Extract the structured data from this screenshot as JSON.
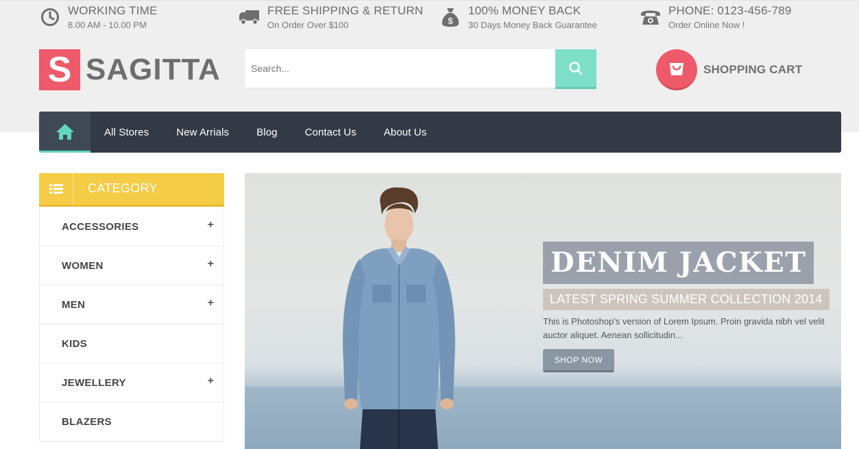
{
  "topbar": {
    "items": [
      {
        "icon": "clock-icon",
        "title": "WORKING TIME",
        "subtitle": "8.00 AM - 10.00 PM"
      },
      {
        "icon": "truck-icon",
        "title": "FREE SHIPPING & RETURN",
        "subtitle": "On Order Over $100"
      },
      {
        "icon": "money-bag-icon",
        "title": "100% MONEY BACK",
        "subtitle": "30 Days Money Back Guarantee"
      },
      {
        "icon": "phone-icon",
        "title": "PHONE: 0123-456-789",
        "subtitle": "Order Online Now !"
      }
    ]
  },
  "logo": {
    "letter": "S",
    "name": "SAGITTA"
  },
  "search": {
    "placeholder": "Search..."
  },
  "cart": {
    "label": "SHOPPING CART"
  },
  "nav": {
    "items": [
      "All Stores",
      "New Arrials",
      "Blog",
      "Contact Us",
      "About Us"
    ]
  },
  "category": {
    "title": "CATEGORY",
    "items": [
      {
        "label": "ACCESSORIES",
        "expand": "+"
      },
      {
        "label": "WOMEN",
        "expand": "+"
      },
      {
        "label": "MEN",
        "expand": "+"
      },
      {
        "label": "KIDS",
        "expand": ""
      },
      {
        "label": "JEWELLERY",
        "expand": "+"
      },
      {
        "label": "BLAZERS",
        "expand": ""
      }
    ]
  },
  "banner": {
    "title": "DENIM JACKET",
    "subtitle": "LATEST SPRING SUMMER COLLECTION 2014",
    "description": "This is Photoshop's version of Lorem Ipsum. Proin gravida nibh vel velit auctor aliquet. Aenean sollicitudin...",
    "button": "SHOP NOW"
  },
  "colors": {
    "brand_red": "#ef5a6b",
    "accent_teal": "#7ddfc8",
    "nav_dark": "#333a46",
    "category_yellow": "#f5cc45"
  }
}
